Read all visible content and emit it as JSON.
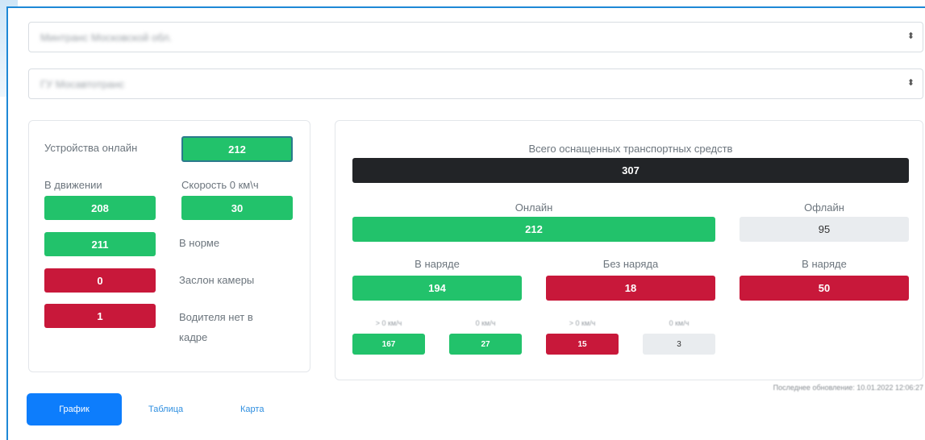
{
  "filters": {
    "select1_value": "Минтранс Московской обл.",
    "select2_value": "ГУ Мосавтотранс",
    "caret": "⬍"
  },
  "left_panel": {
    "devices_online_label": "Устройства онлайн",
    "devices_online_value": "212",
    "in_motion_label": "В движении",
    "in_motion_value": "208",
    "speed_zero_label": "Скорость 0 км\\ч",
    "speed_zero_value": "30",
    "normal_value": "211",
    "normal_label": "В норме",
    "camera_blocked_value": "0",
    "camera_blocked_label": "Заслон камеры",
    "no_driver_value": "1",
    "no_driver_label_line1": "Водителя нет в",
    "no_driver_label_line2": "кадре"
  },
  "right_panel": {
    "total_label": "Всего оснащенных транспортных средств",
    "total_value": "307",
    "online_label": "Онлайн",
    "online_value": "212",
    "offline_label": "Офлайн",
    "offline_value": "95",
    "on_duty_label": "В наряде",
    "on_duty_value": "194",
    "no_duty_label": "Без наряда",
    "no_duty_value": "18",
    "offline_on_duty_label": "В наряде",
    "offline_on_duty_value": "50",
    "small": [
      {
        "label": "> 0 км/ч",
        "value": "167",
        "color": "green"
      },
      {
        "label": "0 км/ч",
        "value": "27",
        "color": "green"
      },
      {
        "label": "> 0 км/ч",
        "value": "15",
        "color": "red"
      },
      {
        "label": "0 км/ч",
        "value": "3",
        "color": "grey"
      }
    ]
  },
  "footer": {
    "tab_chart": "График",
    "tab_table": "Таблица",
    "tab_map": "Карта",
    "last_update": "Последнее обновление: 10.01.2022 12:06:27"
  },
  "colors": {
    "green": "#22c26b",
    "red": "#c8183a",
    "dark": "#222427",
    "primary": "#0d7dfc",
    "frame": "#1e88d6"
  }
}
